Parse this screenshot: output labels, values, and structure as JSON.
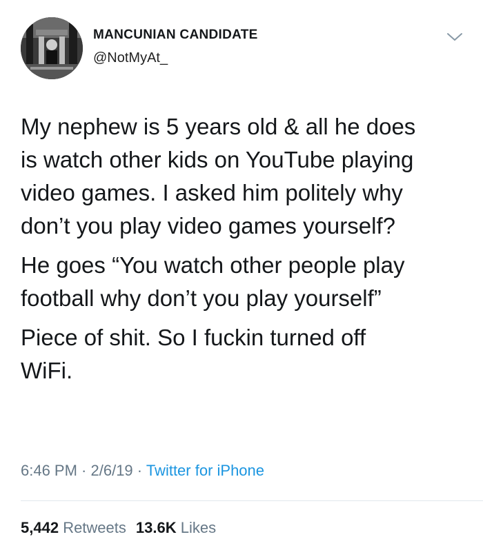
{
  "tweet": {
    "author": {
      "display_name": "MANCUNIAN CANDIDATE",
      "handle": "@NotMyAt_"
    },
    "paragraphs": [
      "My nephew is 5 years old & all he does\nis watch other kids on YouTube playing\nvideo games. I asked him politely why\ndon’t you play video games yourself?",
      "He goes “You watch other people play\nfootball why don’t you play yourself”",
      "Piece of shit. So I fuckin turned off\nWiFi."
    ],
    "meta": {
      "time": "6:46 PM",
      "separator": " · ",
      "date": "2/6/19",
      "source": "Twitter for iPhone"
    },
    "stats": {
      "retweets_count": "5,442",
      "retweets_label": "Retweets",
      "likes_count": "13.6K",
      "likes_label": "Likes"
    }
  },
  "icons": {
    "menu": "chevron-down-icon",
    "avatar": "avatar"
  },
  "colors": {
    "text": "#14171a",
    "muted": "#657786",
    "link": "#1b95e0",
    "divider": "#e1e8ed"
  }
}
